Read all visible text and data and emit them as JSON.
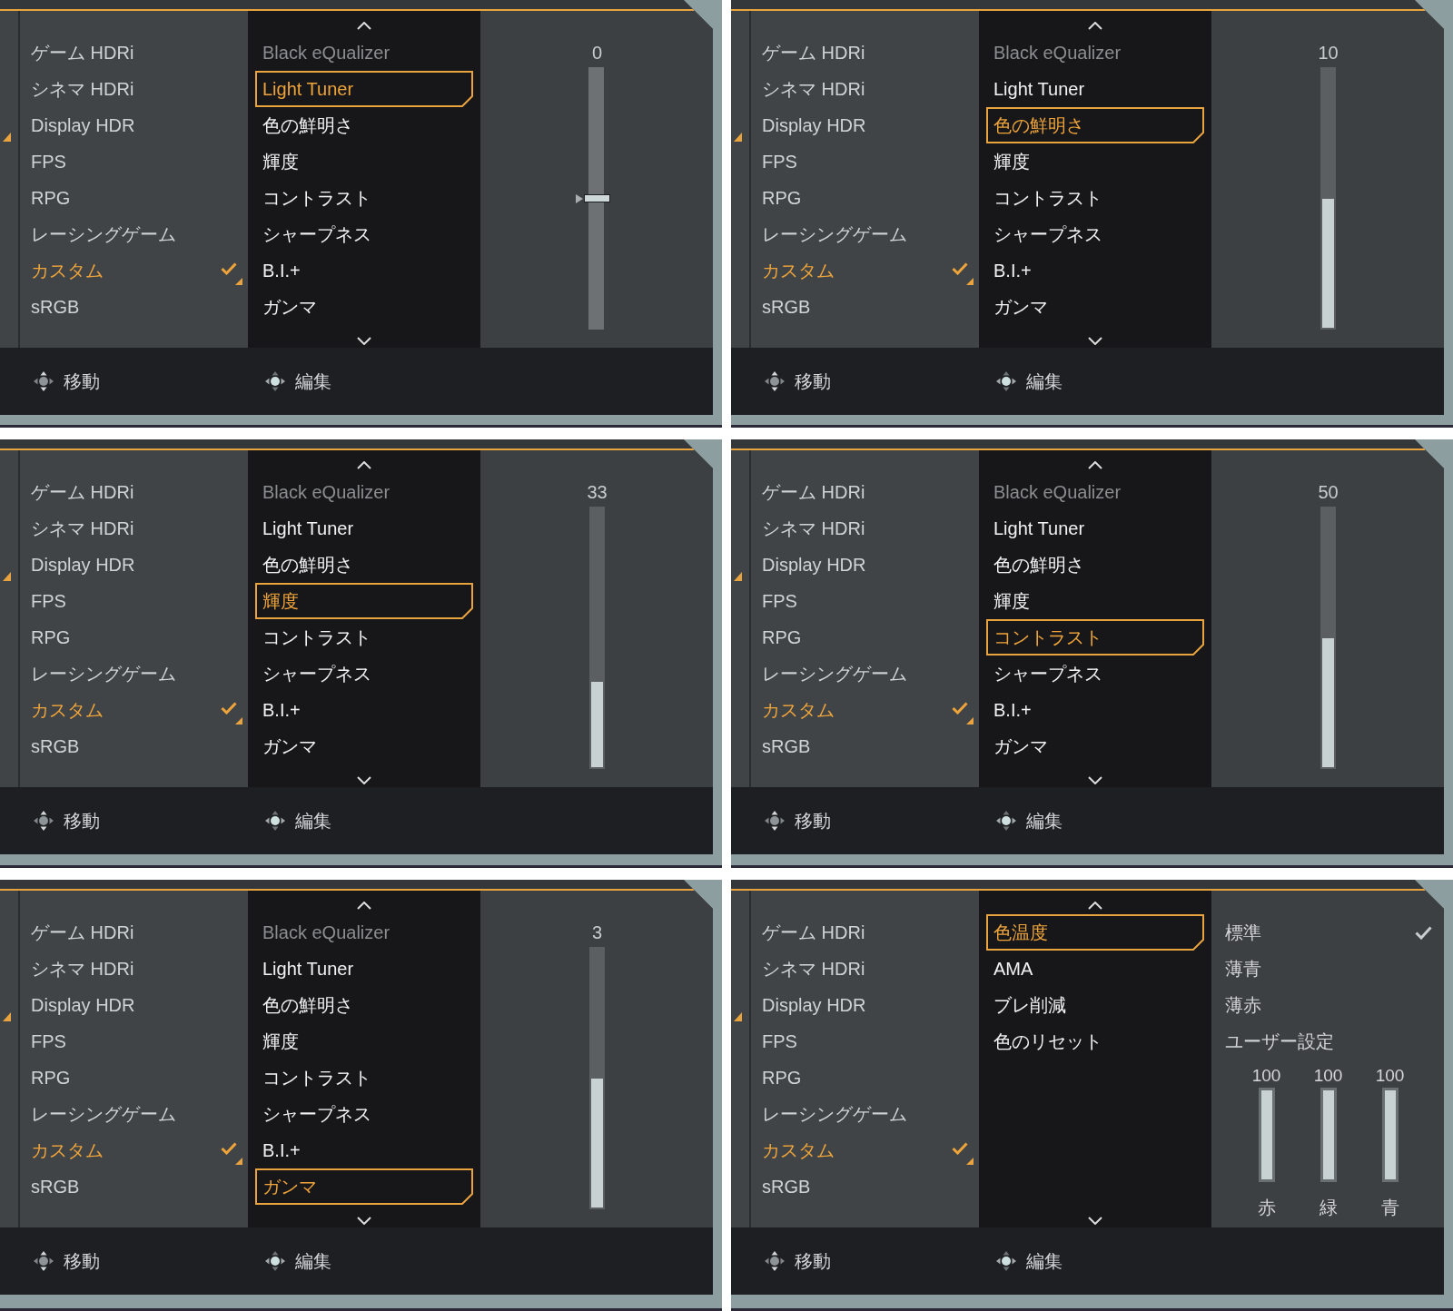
{
  "panels": [
    {
      "modes": [
        {
          "label": "ゲーム HDRi",
          "selected": false
        },
        {
          "label": "シネマ HDRi",
          "selected": false
        },
        {
          "label": "Display HDR",
          "selected": false
        },
        {
          "label": "FPS",
          "selected": false
        },
        {
          "label": "RPG",
          "selected": false
        },
        {
          "label": "レーシングゲーム",
          "selected": false
        },
        {
          "label": "カスタム",
          "selected": true
        },
        {
          "label": "sRGB",
          "selected": false
        }
      ],
      "menu": {
        "items": [
          {
            "label": "Black eQualizer",
            "selected": false,
            "disabled": true
          },
          {
            "label": "Light Tuner",
            "selected": true,
            "disabled": false
          },
          {
            "label": "色の鮮明さ",
            "selected": false,
            "disabled": false
          },
          {
            "label": "輝度",
            "selected": false,
            "disabled": false
          },
          {
            "label": "コントラスト",
            "selected": false,
            "disabled": false
          },
          {
            "label": "シャープネス",
            "selected": false,
            "disabled": false
          },
          {
            "label": "B.I.+",
            "selected": false,
            "disabled": false
          },
          {
            "label": "ガンマ",
            "selected": false,
            "disabled": false
          }
        ]
      },
      "value_panel": {
        "kind": "slider",
        "value": "0",
        "slider": {
          "kind": "thumb",
          "level": 0.5
        }
      },
      "footer": [
        {
          "kind": "move",
          "label": "移動"
        },
        {
          "kind": "press",
          "label": "編集"
        }
      ]
    },
    {
      "modes": [
        {
          "label": "ゲーム HDRi",
          "selected": false
        },
        {
          "label": "シネマ HDRi",
          "selected": false
        },
        {
          "label": "Display HDR",
          "selected": false
        },
        {
          "label": "FPS",
          "selected": false
        },
        {
          "label": "RPG",
          "selected": false
        },
        {
          "label": "レーシングゲーム",
          "selected": false
        },
        {
          "label": "カスタム",
          "selected": true
        },
        {
          "label": "sRGB",
          "selected": false
        }
      ],
      "menu": {
        "items": [
          {
            "label": "Black eQualizer",
            "selected": false,
            "disabled": true
          },
          {
            "label": "Light Tuner",
            "selected": false,
            "disabled": false
          },
          {
            "label": "色の鮮明さ",
            "selected": true,
            "disabled": false
          },
          {
            "label": "輝度",
            "selected": false,
            "disabled": false
          },
          {
            "label": "コントラスト",
            "selected": false,
            "disabled": false
          },
          {
            "label": "シャープネス",
            "selected": false,
            "disabled": false
          },
          {
            "label": "B.I.+",
            "selected": false,
            "disabled": false
          },
          {
            "label": "ガンマ",
            "selected": false,
            "disabled": false
          }
        ]
      },
      "value_panel": {
        "kind": "slider",
        "value": "10",
        "slider": {
          "kind": "fill",
          "level": 0.5
        }
      },
      "footer": [
        {
          "kind": "move",
          "label": "移動"
        },
        {
          "kind": "press",
          "label": "編集"
        }
      ]
    },
    {
      "modes": [
        {
          "label": "ゲーム HDRi",
          "selected": false
        },
        {
          "label": "シネマ HDRi",
          "selected": false
        },
        {
          "label": "Display HDR",
          "selected": false
        },
        {
          "label": "FPS",
          "selected": false
        },
        {
          "label": "RPG",
          "selected": false
        },
        {
          "label": "レーシングゲーム",
          "selected": false
        },
        {
          "label": "カスタム",
          "selected": true
        },
        {
          "label": "sRGB",
          "selected": false
        }
      ],
      "menu": {
        "items": [
          {
            "label": "Black eQualizer",
            "selected": false,
            "disabled": true
          },
          {
            "label": "Light Tuner",
            "selected": false,
            "disabled": false
          },
          {
            "label": "色の鮮明さ",
            "selected": false,
            "disabled": false
          },
          {
            "label": "輝度",
            "selected": true,
            "disabled": false
          },
          {
            "label": "コントラスト",
            "selected": false,
            "disabled": false
          },
          {
            "label": "シャープネス",
            "selected": false,
            "disabled": false
          },
          {
            "label": "B.I.+",
            "selected": false,
            "disabled": false
          },
          {
            "label": "ガンマ",
            "selected": false,
            "disabled": false
          }
        ]
      },
      "value_panel": {
        "kind": "slider",
        "value": "33",
        "slider": {
          "kind": "fill",
          "level": 0.33
        }
      },
      "footer": [
        {
          "kind": "move",
          "label": "移動"
        },
        {
          "kind": "press",
          "label": "編集"
        }
      ]
    },
    {
      "modes": [
        {
          "label": "ゲーム HDRi",
          "selected": false
        },
        {
          "label": "シネマ HDRi",
          "selected": false
        },
        {
          "label": "Display HDR",
          "selected": false
        },
        {
          "label": "FPS",
          "selected": false
        },
        {
          "label": "RPG",
          "selected": false
        },
        {
          "label": "レーシングゲーム",
          "selected": false
        },
        {
          "label": "カスタム",
          "selected": true
        },
        {
          "label": "sRGB",
          "selected": false
        }
      ],
      "menu": {
        "items": [
          {
            "label": "Black eQualizer",
            "selected": false,
            "disabled": true
          },
          {
            "label": "Light Tuner",
            "selected": false,
            "disabled": false
          },
          {
            "label": "色の鮮明さ",
            "selected": false,
            "disabled": false
          },
          {
            "label": "輝度",
            "selected": false,
            "disabled": false
          },
          {
            "label": "コントラスト",
            "selected": true,
            "disabled": false
          },
          {
            "label": "シャープネス",
            "selected": false,
            "disabled": false
          },
          {
            "label": "B.I.+",
            "selected": false,
            "disabled": false
          },
          {
            "label": "ガンマ",
            "selected": false,
            "disabled": false
          }
        ]
      },
      "value_panel": {
        "kind": "slider",
        "value": "50",
        "slider": {
          "kind": "fill",
          "level": 0.5
        }
      },
      "footer": [
        {
          "kind": "move",
          "label": "移動"
        },
        {
          "kind": "press",
          "label": "編集"
        }
      ]
    },
    {
      "modes": [
        {
          "label": "ゲーム HDRi",
          "selected": false
        },
        {
          "label": "シネマ HDRi",
          "selected": false
        },
        {
          "label": "Display HDR",
          "selected": false
        },
        {
          "label": "FPS",
          "selected": false
        },
        {
          "label": "RPG",
          "selected": false
        },
        {
          "label": "レーシングゲーム",
          "selected": false
        },
        {
          "label": "カスタム",
          "selected": true
        },
        {
          "label": "sRGB",
          "selected": false
        }
      ],
      "menu": {
        "items": [
          {
            "label": "Black eQualizer",
            "selected": false,
            "disabled": true
          },
          {
            "label": "Light Tuner",
            "selected": false,
            "disabled": false
          },
          {
            "label": "色の鮮明さ",
            "selected": false,
            "disabled": false
          },
          {
            "label": "輝度",
            "selected": false,
            "disabled": false
          },
          {
            "label": "コントラスト",
            "selected": false,
            "disabled": false
          },
          {
            "label": "シャープネス",
            "selected": false,
            "disabled": false
          },
          {
            "label": "B.I.+",
            "selected": false,
            "disabled": false
          },
          {
            "label": "ガンマ",
            "selected": true,
            "disabled": false
          }
        ]
      },
      "value_panel": {
        "kind": "slider",
        "value": "3",
        "slider": {
          "kind": "fill",
          "level": 0.5
        }
      },
      "footer": [
        {
          "kind": "move",
          "label": "移動"
        },
        {
          "kind": "press",
          "label": "編集"
        }
      ]
    },
    {
      "modes": [
        {
          "label": "ゲーム HDRi",
          "selected": false
        },
        {
          "label": "シネマ HDRi",
          "selected": false
        },
        {
          "label": "Display HDR",
          "selected": false
        },
        {
          "label": "FPS",
          "selected": false
        },
        {
          "label": "RPG",
          "selected": false
        },
        {
          "label": "レーシングゲーム",
          "selected": false
        },
        {
          "label": "カスタム",
          "selected": true
        },
        {
          "label": "sRGB",
          "selected": false
        }
      ],
      "menu": {
        "items": [
          {
            "label": "色温度",
            "selected": true,
            "disabled": false
          },
          {
            "label": "AMA",
            "selected": false,
            "disabled": false
          },
          {
            "label": "ブレ削減",
            "selected": false,
            "disabled": false
          },
          {
            "label": "色のリセット",
            "selected": false,
            "disabled": false
          }
        ]
      },
      "value_panel": {
        "kind": "options",
        "options": [
          {
            "label": "標準",
            "selected": true
          },
          {
            "label": "薄青",
            "selected": false
          },
          {
            "label": "薄赤",
            "selected": false
          },
          {
            "label": "ユーザー設定",
            "selected": false
          }
        ],
        "channels": [
          {
            "value": "100",
            "label": "赤",
            "level": 1
          },
          {
            "value": "100",
            "label": "緑",
            "level": 1
          },
          {
            "value": "100",
            "label": "青",
            "level": 1
          }
        ]
      },
      "footer": [
        {
          "kind": "move",
          "label": "移動"
        },
        {
          "kind": "press",
          "label": "編集"
        }
      ]
    }
  ]
}
